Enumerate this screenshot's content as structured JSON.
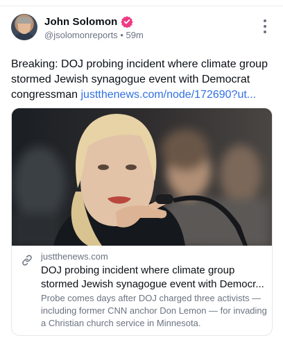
{
  "post": {
    "author_name": "John Solomon",
    "handle": "@jsolomonreports",
    "separator": "•",
    "time": "59m",
    "text": "Breaking: DOJ probing incident where climate group stormed Jewish synagogue event with Democrat congressman",
    "link_text": "justthenews.com/node/172690?ut...",
    "verified_color": "#ec3b83"
  },
  "card": {
    "domain": "justthenews.com",
    "title_line1": "DOJ probing incident where climate group",
    "title_line2": "stormed Jewish synagogue event with Democr...",
    "description": "Probe comes days after DOJ charged three activists — including former CNN anchor Don Lemon — for invading a Christian church service in Minnesota."
  },
  "icons": {
    "verified": "verified-badge-icon",
    "menu": "more-vertical-icon",
    "link": "link-icon"
  }
}
